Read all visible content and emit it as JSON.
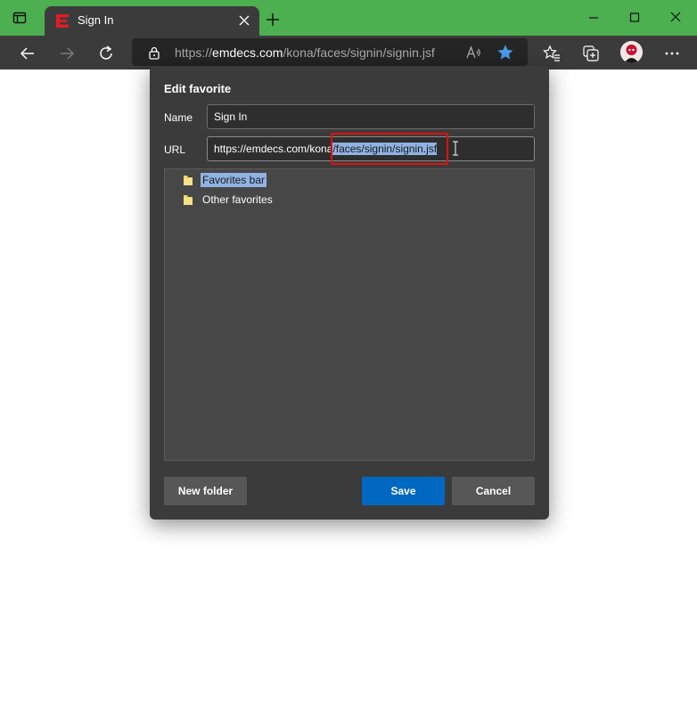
{
  "browser": {
    "tab": {
      "title": "Sign In",
      "favicon": "E"
    },
    "address": {
      "scheme": "https://",
      "host": "emdecs.com",
      "path": "/kona/faces/signin/signin.jsf"
    },
    "colors": {
      "tab_bar": "#4caf50",
      "toolbar": "#3b3b3b",
      "favicon": "#e01c24",
      "star": "#4a9be8"
    }
  },
  "dialog": {
    "title": "Edit favorite",
    "name_label": "Name",
    "name_value": "Sign In",
    "url_label": "URL",
    "url_prefix": "https://emdecs.com/kona",
    "url_selected": "/faces/signin/signin.jsf",
    "folders": [
      {
        "label": "Favorites bar",
        "selected": true
      },
      {
        "label": "Other favorites",
        "selected": false
      }
    ],
    "buttons": {
      "new_folder": "New folder",
      "save": "Save",
      "cancel": "Cancel"
    },
    "colors": {
      "save": "#0068c0",
      "selection": "#8fb3e3",
      "highlight": "#e01010"
    }
  }
}
